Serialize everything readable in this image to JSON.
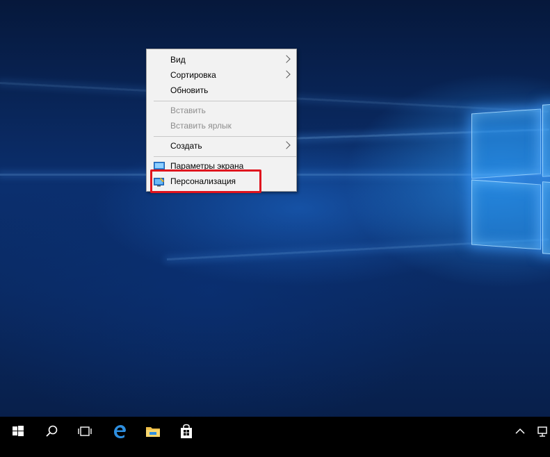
{
  "context_menu": {
    "items": [
      {
        "label": "Вид",
        "disabled": false,
        "submenu": true
      },
      {
        "label": "Сортировка",
        "disabled": false,
        "submenu": true
      },
      {
        "label": "Обновить",
        "disabled": false,
        "submenu": false
      },
      {
        "label": "Вставить",
        "disabled": true,
        "submenu": false
      },
      {
        "label": "Вставить ярлык",
        "disabled": true,
        "submenu": false
      },
      {
        "label": "Создать",
        "disabled": false,
        "submenu": true
      },
      {
        "label": "Параметры экрана",
        "disabled": false,
        "submenu": false,
        "icon": "display-settings-icon"
      },
      {
        "label": "Персонализация",
        "disabled": false,
        "submenu": false,
        "icon": "personalization-icon"
      }
    ]
  },
  "highlight": {
    "target": "Персонализация",
    "color": "#e0141e"
  },
  "taskbar": {
    "buttons": [
      "start-icon",
      "search-icon",
      "task-view-icon",
      "edge-icon",
      "file-explorer-icon",
      "store-icon"
    ],
    "tray": [
      "show-hidden-icons-chevron",
      "network-icon"
    ]
  },
  "colors": {
    "menu_bg": "#f2f2f2",
    "taskbar_bg": "#000000",
    "accent": "#1e90ff"
  }
}
